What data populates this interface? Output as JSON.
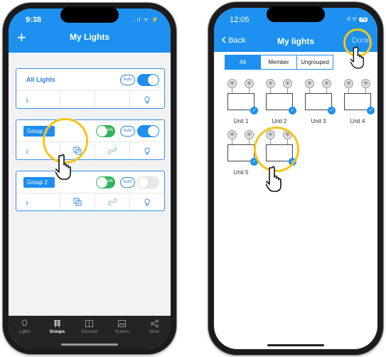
{
  "left_phone": {
    "status_time": "9:38",
    "status_icons": "..ıl ᯤ ⚡",
    "header_plus": "+",
    "title": "My Lights",
    "cards": [
      {
        "title": "All Lights",
        "auto": "Auto",
        "chevron": "›",
        "power_on": true
      },
      {
        "group": "Group 1",
        "link": "Link",
        "auto": "Auto",
        "chevron": "›",
        "power_on": true
      },
      {
        "group": "Group 2",
        "link": "Link",
        "auto": "Auto",
        "chevron": "›",
        "power_on": false
      }
    ],
    "tabs": [
      {
        "label": "Lights",
        "icon": "bulb-icon"
      },
      {
        "label": "Groups",
        "icon": "grid-icon",
        "active": true
      },
      {
        "label": "Discover",
        "icon": "book-icon"
      },
      {
        "label": "Scenes",
        "icon": "image-icon"
      },
      {
        "label": "More",
        "icon": "share-icon"
      }
    ]
  },
  "right_phone": {
    "status_time": "12:05",
    "battery": "70",
    "back": "Back",
    "title": "My lights",
    "done": "Done",
    "segments": [
      "All",
      "Member",
      "Ungrouped"
    ],
    "active_segment": "All",
    "units": [
      "Unit 1",
      "Unit 2",
      "Unit 3",
      "Unit 4",
      "Unit 5",
      ""
    ]
  },
  "colors": {
    "brand_blue": "#1e90ef",
    "link_green": "#2fb35b",
    "highlight_ring": "#f5c518",
    "tabbar": "#242424"
  }
}
